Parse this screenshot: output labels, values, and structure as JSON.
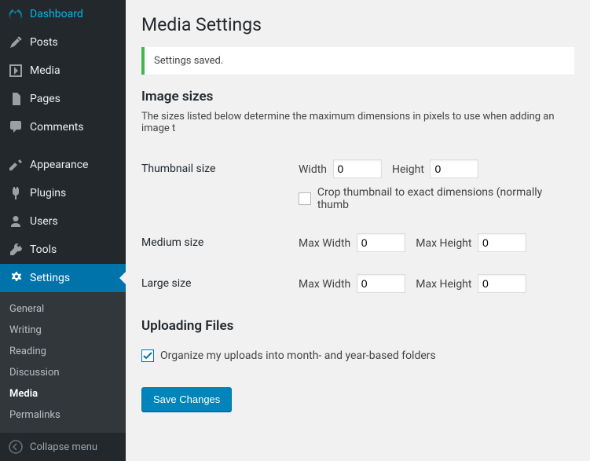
{
  "sidebar": {
    "items": [
      {
        "label": "Dashboard"
      },
      {
        "label": "Posts"
      },
      {
        "label": "Media"
      },
      {
        "label": "Pages"
      },
      {
        "label": "Comments"
      },
      {
        "label": "Appearance"
      },
      {
        "label": "Plugins"
      },
      {
        "label": "Users"
      },
      {
        "label": "Tools"
      },
      {
        "label": "Settings"
      }
    ],
    "submenu": [
      {
        "label": "General"
      },
      {
        "label": "Writing"
      },
      {
        "label": "Reading"
      },
      {
        "label": "Discussion"
      },
      {
        "label": "Media"
      },
      {
        "label": "Permalinks"
      }
    ],
    "collapse_label": "Collapse menu"
  },
  "page": {
    "title": "Media Settings",
    "notice_text": "Settings saved.",
    "section_image_sizes": "Image sizes",
    "image_sizes_desc": "The sizes listed below determine the maximum dimensions in pixels to use when adding an image t",
    "thumbnail_label": "Thumbnail size",
    "width_label": "Width",
    "height_label": "Height",
    "thumb_width": "0",
    "thumb_height": "0",
    "crop_label": "Crop thumbnail to exact dimensions (normally thumb",
    "medium_label": "Medium size",
    "maxwidth_label": "Max Width",
    "maxheight_label": "Max Height",
    "medium_width": "0",
    "medium_height": "0",
    "large_label": "Large size",
    "large_width": "0",
    "large_height": "0",
    "section_upload": "Uploading Files",
    "organize_label": "Organize my uploads into month- and year-based folders",
    "submit_label": "Save Changes"
  }
}
